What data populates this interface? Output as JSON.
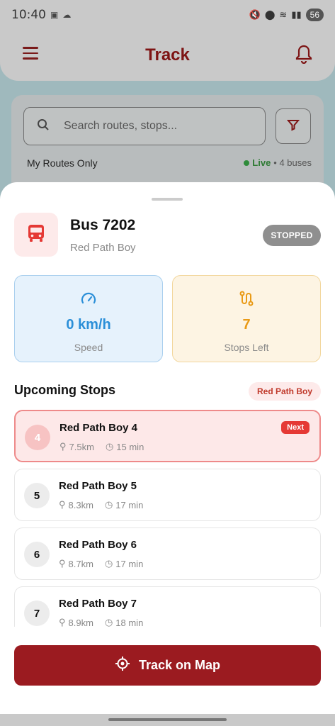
{
  "status_bar": {
    "time": "10:40",
    "battery": "56"
  },
  "header": {
    "title": "Track"
  },
  "search": {
    "placeholder": "Search routes, stops..."
  },
  "filters": {
    "my_routes_label": "My Routes Only",
    "live_label": "Live",
    "bus_count": "• 4 buses"
  },
  "bus": {
    "name": "Bus 7202",
    "route": "Red Path Boy",
    "status": "STOPPED"
  },
  "stats": {
    "speed": {
      "value": "0 km/h",
      "label": "Speed"
    },
    "stops_left": {
      "value": "7",
      "label": "Stops Left"
    }
  },
  "upcoming": {
    "title": "Upcoming Stops",
    "route_chip": "Red Path Boy",
    "stops": [
      {
        "num": "4",
        "name": "Red Path Boy 4",
        "distance": "7.5km",
        "eta": "15 min",
        "badge": "Next"
      },
      {
        "num": "5",
        "name": "Red Path Boy 5",
        "distance": "8.3km",
        "eta": "17 min"
      },
      {
        "num": "6",
        "name": "Red Path Boy 6",
        "distance": "8.7km",
        "eta": "17 min"
      },
      {
        "num": "7",
        "name": "Red Path Boy 7",
        "distance": "8.9km",
        "eta": "18 min"
      }
    ]
  },
  "actions": {
    "track_button": "Track on Map"
  },
  "colors": {
    "brand": "#9b1b20",
    "speed": "#2b8fd8",
    "stops": "#e99a16",
    "live": "#2e8b3a"
  }
}
